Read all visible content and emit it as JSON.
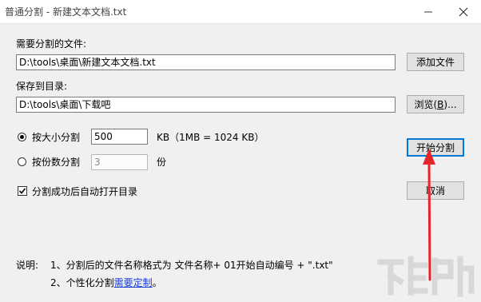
{
  "window": {
    "title": "普通分割 - 新建文本文档.txt",
    "minimize_glyph": "—",
    "close_glyph": "✕"
  },
  "split_file": {
    "label": "需要分割的文件:",
    "value": "D:\\tools\\桌面\\新建文本文档.txt",
    "add_button": "添加文件"
  },
  "save_to": {
    "label": "保存到目录:",
    "value": "D:\\tools\\桌面\\下载吧",
    "browse_button_prefix": "浏览(",
    "browse_button_key": "B",
    "browse_button_suffix": ")..."
  },
  "by_size": {
    "label": "按大小分割",
    "value": "500",
    "unit": "KB（1MB = 1024 KB）",
    "selected": true
  },
  "by_count": {
    "label": "按份数分割",
    "value": "3",
    "unit": "份",
    "selected": false
  },
  "auto_open": {
    "label": "分割成功后自动打开目录",
    "checked": true
  },
  "buttons": {
    "start": "开始分割",
    "cancel": "取消"
  },
  "notes": {
    "heading": "说明:",
    "line1": "1、分割后的文件名称格式为   文件名称+ 01开始自动编号 + \".txt\"",
    "line2_prefix": "2、个性化分割",
    "line2_link": "需要定制",
    "line2_suffix": "。"
  },
  "annotation": {
    "arrow_color": "#e8242b"
  },
  "colors": {
    "window_bg": "#f0f0f0",
    "accent": "#0078d7",
    "link": "#1a3dd8"
  }
}
